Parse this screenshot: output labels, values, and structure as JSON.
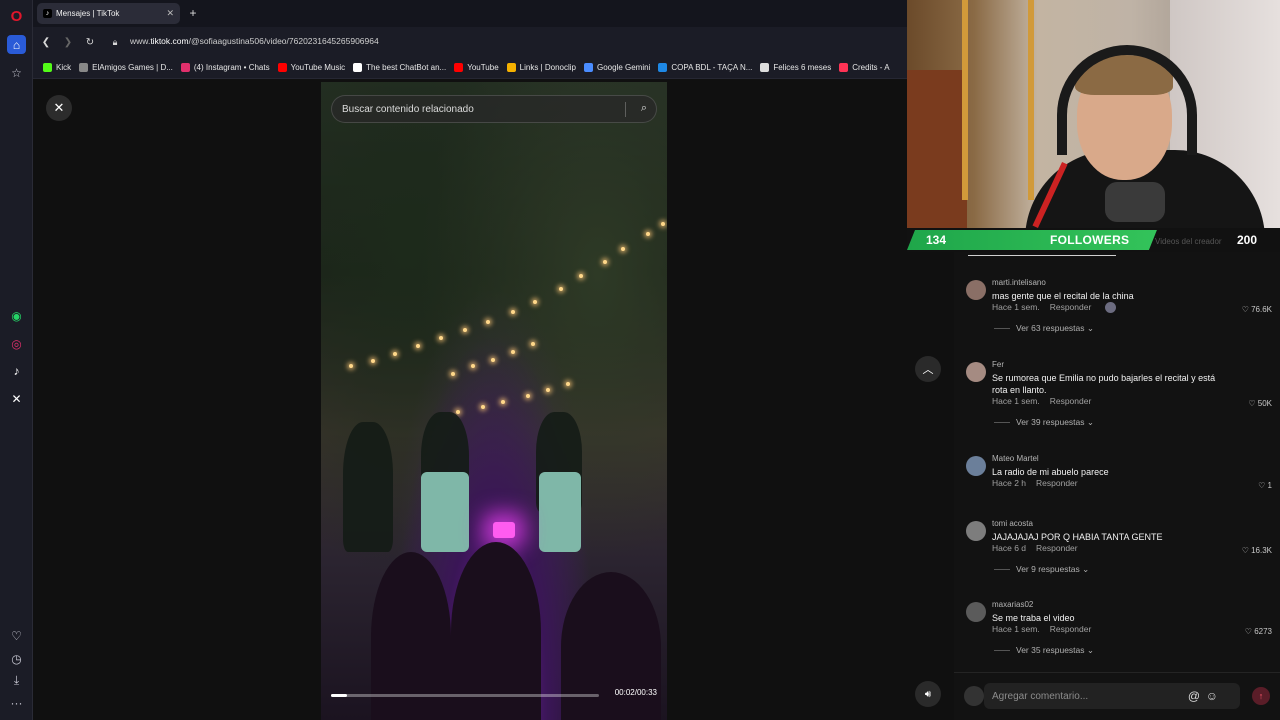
{
  "browser": {
    "tab_title": "Mensajes | TikTok",
    "url_prefix": "www.",
    "url_host": "tiktok.com",
    "url_path": "/@sofiaagustina506/video/7620231645265906964",
    "bookmarks": [
      {
        "label": "Kick",
        "color": "#53fc18"
      },
      {
        "label": "ElAmigos Games | D...",
        "color": "#888888"
      },
      {
        "label": "(4) Instagram • Chats",
        "color": "#e1306c"
      },
      {
        "label": "YouTube Music",
        "color": "#ff0000"
      },
      {
        "label": "The best ChatBot an...",
        "color": "#ffffff"
      },
      {
        "label": "YouTube",
        "color": "#ff0000"
      },
      {
        "label": "Links | Donoclip",
        "color": "#f5b100"
      },
      {
        "label": "Google Gemini",
        "color": "#4a8cff"
      },
      {
        "label": "COPA BDL - TAÇA N...",
        "color": "#1e88e5"
      },
      {
        "label": "Felices 6 meses",
        "color": "#dddddd"
      },
      {
        "label": "Credits - A",
        "color": "#ff3355"
      }
    ]
  },
  "sidebar_icons": [
    "opera-logo",
    "home-icon",
    "star-icon",
    "whatsapp-icon",
    "instagram-icon",
    "tiktok-icon",
    "x-icon",
    "heart-icon",
    "history-icon",
    "download-icon",
    "more-icon"
  ],
  "video": {
    "search_placeholder": "Buscar contenido relacionado",
    "time": "00:02/00:33",
    "progress": 0.06
  },
  "overlay": {
    "followers_current": "134",
    "followers_label": "FOLLOWERS",
    "followers_goal": "200",
    "ghost_text": "Videos del creador",
    "progress": 0.67
  },
  "comments": [
    {
      "user": "marti.intelisano",
      "text": "mas gente que el recital de la china",
      "time": "Hace 1 sem.",
      "reply": "Responder",
      "likes": "76.6K",
      "replies": "Ver 63 respuestas",
      "creator_liked": true
    },
    {
      "user": "Fer",
      "text": "Se rumorea que Emilia no pudo bajarles el recital y está rota en llanto.",
      "time": "Hace 1 sem.",
      "reply": "Responder",
      "likes": "50K",
      "replies": "Ver 39 respuestas"
    },
    {
      "user": "Mateo Martel",
      "text": "La radio de mi abuelo parece",
      "time": "Hace 2 h",
      "reply": "Responder",
      "likes": "1",
      "replies": ""
    },
    {
      "user": "tomi acosta",
      "text": "JAJAJAJAJ POR Q HABIA TANTA GENTE",
      "time": "Hace 6 d",
      "reply": "Responder",
      "likes": "16.3K",
      "replies": "Ver 9 respuestas"
    },
    {
      "user": "maxarias02",
      "text": "Se me traba el video",
      "time": "Hace 1 sem.",
      "reply": "Responder",
      "likes": "6273",
      "replies": "Ver 35 respuestas"
    }
  ],
  "comment_input": {
    "placeholder": "Agregar comentario..."
  }
}
